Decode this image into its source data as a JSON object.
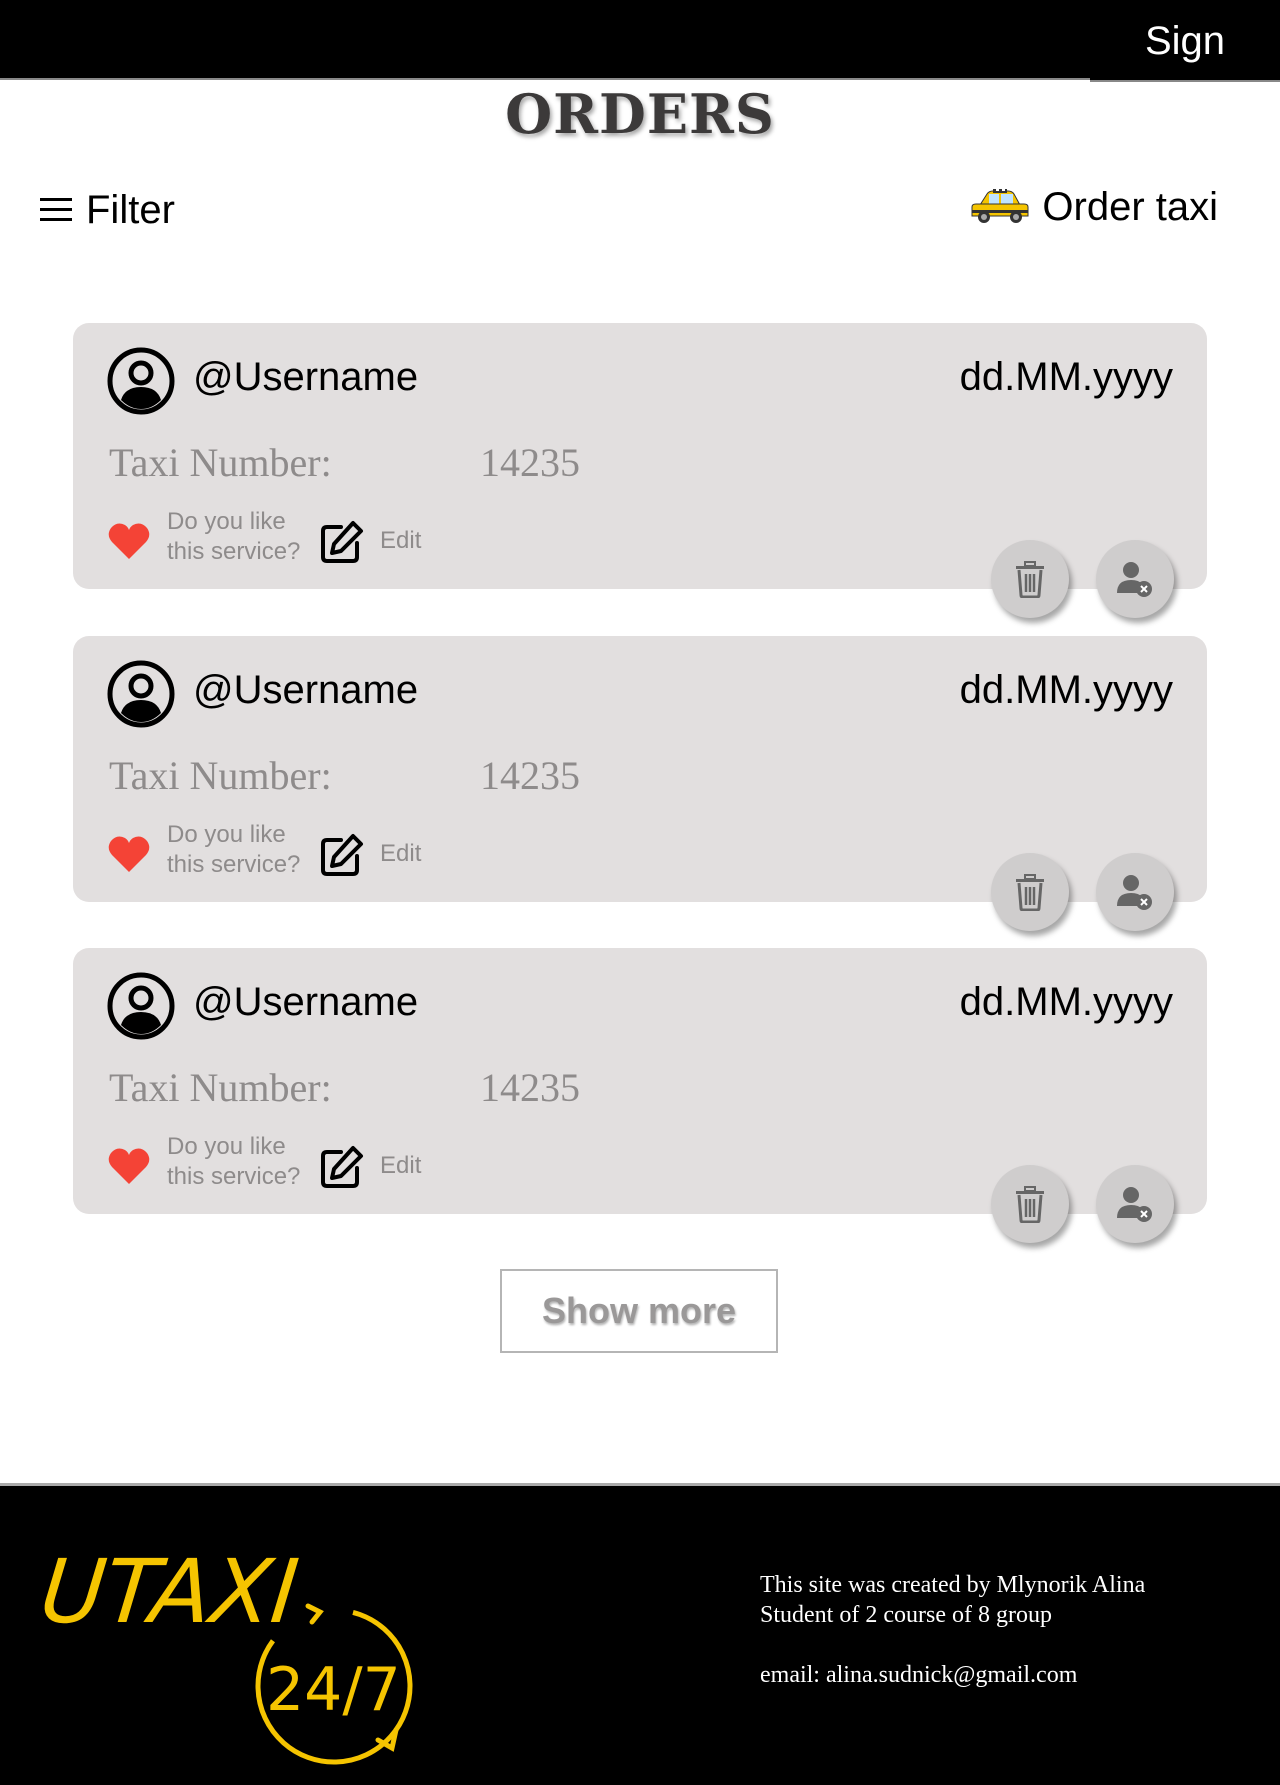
{
  "header": {
    "sign_label": "Sign"
  },
  "page_title": "ORDERS",
  "toolbar": {
    "filter_label": "Filter",
    "order_taxi_label": "Order taxi"
  },
  "orders": [
    {
      "username": "@Username",
      "date": "dd.MM.yyyy",
      "taxi_number_label": "Taxi Number:",
      "taxi_number": "14235",
      "like_line1": "Do you like",
      "like_line2": "this service?",
      "edit_label": "Edit"
    },
    {
      "username": "@Username",
      "date": "dd.MM.yyyy",
      "taxi_number_label": "Taxi Number:",
      "taxi_number": "14235",
      "like_line1": "Do you like",
      "like_line2": "this service?",
      "edit_label": "Edit"
    },
    {
      "username": "@Username",
      "date": "dd.MM.yyyy",
      "taxi_number_label": "Taxi Number:",
      "taxi_number": "14235",
      "like_line1": "Do you like",
      "like_line2": "this service?",
      "edit_label": "Edit"
    }
  ],
  "show_more_label": "Show more",
  "footer": {
    "logo_text": "UTAXI",
    "logo_sub": "24/7",
    "line1": "This site was created by Mlynorik Alina",
    "line2": "Student of 2 course of 8 group",
    "email": "email: alina.sudnick@gmail.com"
  },
  "colors": {
    "header_bg": "#000000",
    "card_bg": "#e2dfdf",
    "heart": "#f44336",
    "logo_yellow": "#f5c400",
    "muted_text": "#8e8b8b"
  },
  "icons": [
    "menu-icon",
    "taxi-icon",
    "user-avatar-icon",
    "heart-icon",
    "edit-icon",
    "trash-icon",
    "remove-user-icon"
  ]
}
